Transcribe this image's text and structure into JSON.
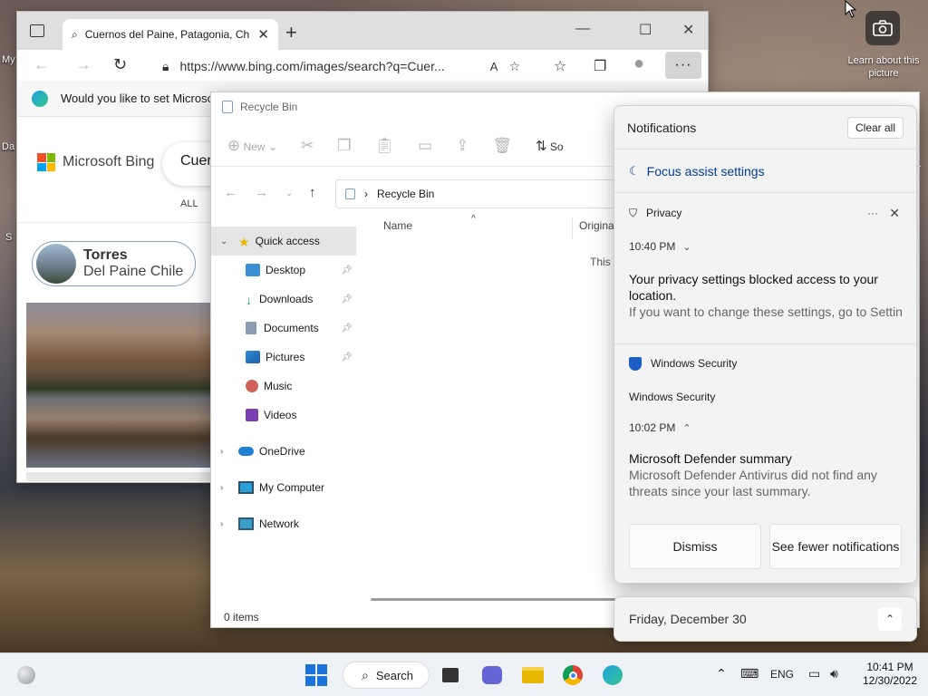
{
  "desktop": {
    "side_labels": [
      "My",
      "Da",
      "S"
    ],
    "learn_about": "Learn about this picture"
  },
  "browser": {
    "tab_title": "Cuernos del Paine, Patagonia, Ch",
    "tab_close": "✕",
    "new_tab": "+",
    "url": "https://www.bing.com/images/search?q=Cuer...",
    "infobar_text": "Would you like to set Microso",
    "bing_brand": "Microsoft Bing",
    "search_text": "Cuer",
    "nav_all": "ALL",
    "chip": {
      "line1": "Torres",
      "line2": "Del Paine Chile"
    }
  },
  "explorer": {
    "title": "Recycle Bin",
    "new_label": "New",
    "sort_label": "So",
    "path": "Recycle Bin",
    "columns": {
      "name": "Name",
      "original": "Origina"
    },
    "empty_text": "This f",
    "status": "0 items",
    "sidebar": [
      {
        "label": "Quick access",
        "expandable": true,
        "selected": true,
        "pinned": false,
        "icon": "star-icon"
      },
      {
        "label": "Desktop",
        "expandable": false,
        "selected": false,
        "pinned": true,
        "icon": "desktop-icon"
      },
      {
        "label": "Downloads",
        "expandable": false,
        "selected": false,
        "pinned": true,
        "icon": "download-icon"
      },
      {
        "label": "Documents",
        "expandable": false,
        "selected": false,
        "pinned": true,
        "icon": "document-icon"
      },
      {
        "label": "Pictures",
        "expandable": false,
        "selected": false,
        "pinned": true,
        "icon": "pictures-icon"
      },
      {
        "label": "Music",
        "expandable": false,
        "selected": false,
        "pinned": false,
        "icon": "music-icon"
      },
      {
        "label": "Videos",
        "expandable": false,
        "selected": false,
        "pinned": false,
        "icon": "videos-icon"
      },
      {
        "label": "OneDrive",
        "expandable": true,
        "selected": false,
        "pinned": false,
        "icon": "cloud-icon"
      },
      {
        "label": "My Computer",
        "expandable": true,
        "selected": false,
        "pinned": false,
        "icon": "computer-icon"
      },
      {
        "label": "Network",
        "expandable": true,
        "selected": false,
        "pinned": false,
        "icon": "network-icon"
      }
    ]
  },
  "notifications": {
    "title": "Notifications",
    "clear_all": "Clear all",
    "focus_assist": "Focus assist settings",
    "privacy": {
      "app": "Privacy",
      "more": "···",
      "time": "10:40 PM",
      "title": "Your privacy settings blocked access to your location.",
      "body": "If you want to change these settings, go to Settin"
    },
    "security": {
      "app": "Windows Security",
      "subtitle": "Windows Security",
      "time": "10:02 PM",
      "title": "Microsoft Defender summary",
      "body": "Microsoft Defender Antivirus did not find any threats since your last summary."
    },
    "dismiss": "Dismiss",
    "see_fewer": "See fewer notifications",
    "date": "Friday, December 30"
  },
  "taskbar": {
    "search": "Search",
    "lang": "ENG",
    "time": "10:41 PM",
    "date": "12/30/2022"
  },
  "colors": {
    "accent": "#0067c0",
    "focus_link": "#003e92",
    "folder": "#e8b800"
  }
}
